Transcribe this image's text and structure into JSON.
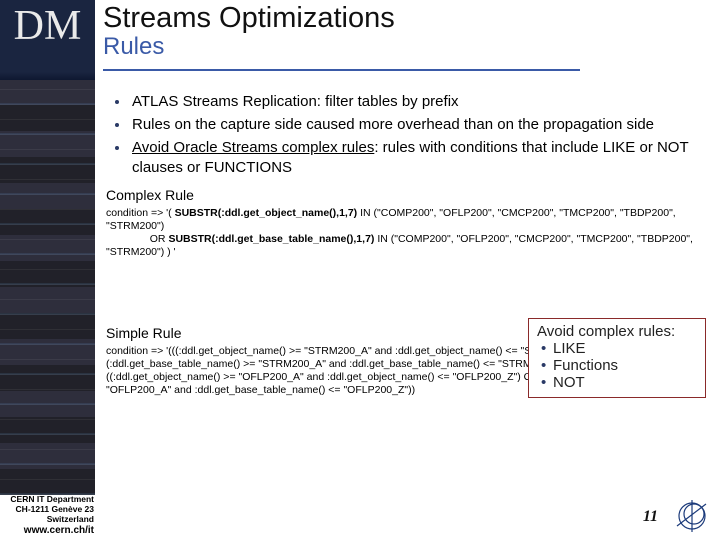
{
  "banner": {
    "dm": "DM",
    "title": "Streams Optimizations",
    "subtitle": "Rules",
    "logo_cern": "CERN",
    "logo_it": "IT",
    "logo_dept": "Department"
  },
  "bullets": [
    "ATLAS Streams Replication: filter tables by prefix",
    "Rules on the capture side caused more overhead than on the propagation side",
    "Avoid Oracle Streams complex rules: rules with conditions that include LIKE or NOT clauses or FUNCTIONS"
  ],
  "avoid_phrase": "Avoid Oracle Streams complex rules",
  "complex_rule_label": "Complex Rule",
  "complex_rule_code": "condition => '( SUBSTR(:ddl.get_object_name(),1,7) IN (\"COMP200\", \"OFLP200\", \"CMCP200\", \"TMCP200\", \"TBDP200\", \"STRM200\")\n               OR SUBSTR(:ddl.get_base_table_name(),1,7) IN (\"COMP200\", \"OFLP200\", \"CMCP200\", \"TMCP200\", \"TBDP200\", \"STRM200\") ) '",
  "hl1": "SUBSTR(:ddl.get_object_name(),1,7)",
  "hl2": "SUBSTR(:ddl.get_base_table_name(),1,7)",
  "simple_rule_label": "Simple Rule",
  "simple_rule_code": "condition => '(((:ddl.get_object_name() >= \"STRM200_A\" and :ddl.get_object_name() <= \"STRM200_Z\") OR (:ddl.get_base_table_name() >= \"STRM200_A\" and :ddl.get_base_table_name() <= \"STRM200_Z\")) OR ((:ddl.get_object_name() >= \"OFLP200_A\" and :ddl.get_object_name() <= \"OFLP200_Z\") OR (:ddl.get_base_table_name() >= \"OFLP200_A\" and :ddl.get_base_table_name() <= \"OFLP200_Z\"))",
  "warn": {
    "title": "Avoid complex rules:",
    "items": [
      "LIKE",
      "Functions",
      "NOT"
    ]
  },
  "footer": {
    "line1": "CERN IT Department",
    "line2": "CH-1211 Genève 23",
    "line3": "Switzerland",
    "url": "www.cern.ch/it",
    "page": "11"
  },
  "colors": {
    "accent": "#3a5aa7",
    "banner": "#1a2540",
    "warn_border": "#8a2a2a"
  }
}
